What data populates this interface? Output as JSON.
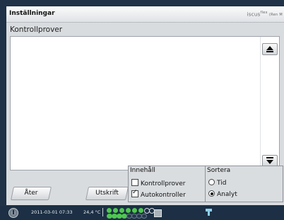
{
  "window": {
    "title": "Inställningar",
    "brand": "iscus",
    "brand_sup": "flex",
    "brand_small": "(Ren M"
  },
  "main": {
    "subtitle": "Kontrollprover",
    "list_items": []
  },
  "buttons": {
    "back": "Åter",
    "print": "Utskrift"
  },
  "content_group": {
    "title": "Innehåll",
    "options": [
      {
        "label": "Kontrollprover",
        "checked": false
      },
      {
        "label": "Autokontroller",
        "checked": true
      }
    ]
  },
  "sort_group": {
    "title": "Sortera",
    "options": [
      {
        "label": "Tid",
        "selected": false
      },
      {
        "label": "Analyt",
        "selected": true
      }
    ]
  },
  "taskbar": {
    "datetime": "2011-03-01 07:33",
    "temperature": "24,4 °C"
  },
  "colors": {
    "taskbar_bg": "#1c2f44",
    "window_bg": "#d9dcdf",
    "status_green": "#4fc84f"
  },
  "icons": [
    "power-icon",
    "scroll-up-icon",
    "scroll-down-icon",
    "network-icon"
  ]
}
